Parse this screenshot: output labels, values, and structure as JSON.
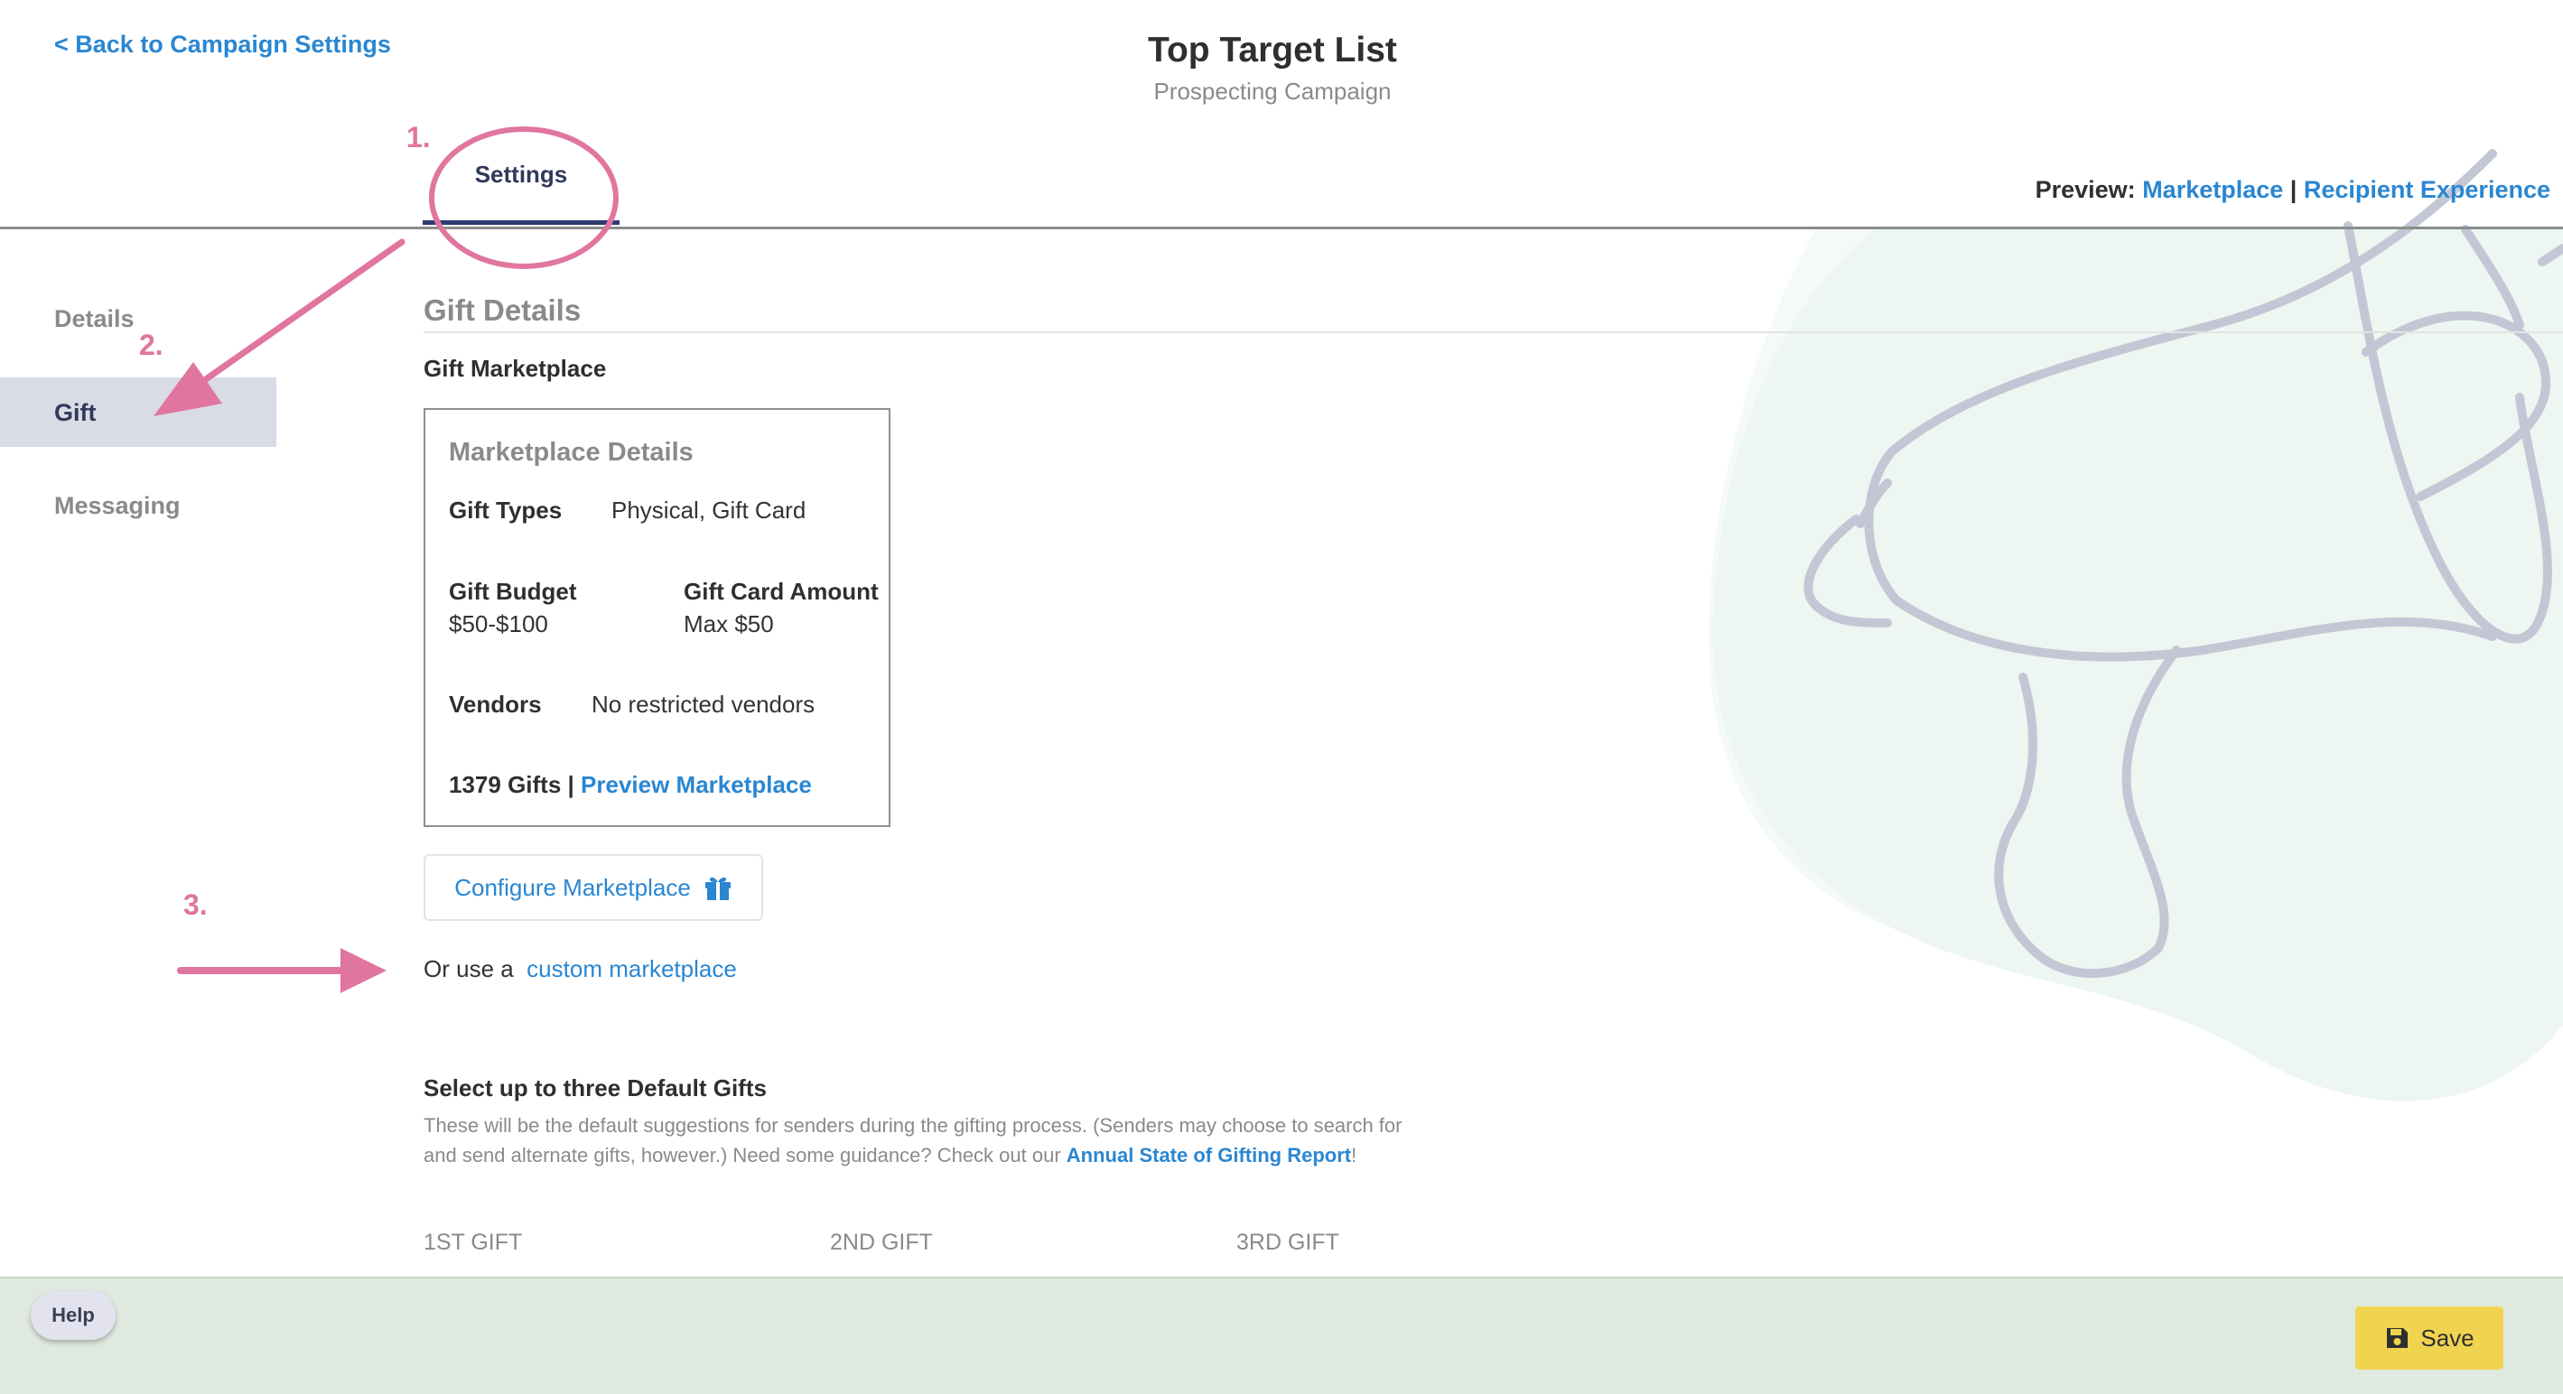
{
  "header": {
    "back_link": "< Back to Campaign Settings",
    "title": "Top Target List",
    "subtitle": "Prospecting Campaign"
  },
  "tabs": [
    {
      "label": "Settings",
      "active": true
    }
  ],
  "preview": {
    "label": "Preview:",
    "marketplace": "Marketplace",
    "separator": "|",
    "recipient": "Recipient Experience"
  },
  "sidebar": {
    "items": [
      {
        "label": "Details",
        "active": false
      },
      {
        "label": "Gift",
        "active": true
      },
      {
        "label": "Messaging",
        "active": false
      }
    ]
  },
  "main": {
    "section_title": "Gift Details",
    "marketplace_label": "Gift Marketplace",
    "details_box": {
      "title": "Marketplace Details",
      "gift_types_label": "Gift Types",
      "gift_types_value": "Physical, Gift Card",
      "gift_budget_label": "Gift Budget",
      "gift_budget_value": "$50-$100",
      "gift_card_amount_label": "Gift Card Amount",
      "gift_card_amount_value": "Max $50",
      "vendors_label": "Vendors",
      "vendors_value": "No restricted vendors",
      "gift_count": "1379 Gifts",
      "count_separator": "|",
      "preview_link": "Preview Marketplace"
    },
    "configure_button": "Configure Marketplace",
    "or_use_text": "Or use a",
    "custom_marketplace_link": "custom marketplace",
    "default_gifts": {
      "title": "Select up to three Default Gifts",
      "description": "These will be the default suggestions for senders during the gifting process. (Senders may choose to search for and send alternate gifts, however.) Need some guidance? Check out our",
      "report_link": "Annual State of Gifting Report",
      "description_end": "!",
      "columns": [
        "1ST GIFT",
        "2ND GIFT",
        "3RD GIFT"
      ]
    }
  },
  "footer": {
    "help_label": "Help",
    "save_label": "Save"
  },
  "annotations": {
    "step1": "1.",
    "step2": "2.",
    "step3": "3.",
    "color": "#e0769f"
  },
  "colors": {
    "link": "#2a86d1",
    "active_tab": "#2f3a72",
    "save_button": "#f0d44f",
    "footer_bg": "#dfe9df"
  }
}
